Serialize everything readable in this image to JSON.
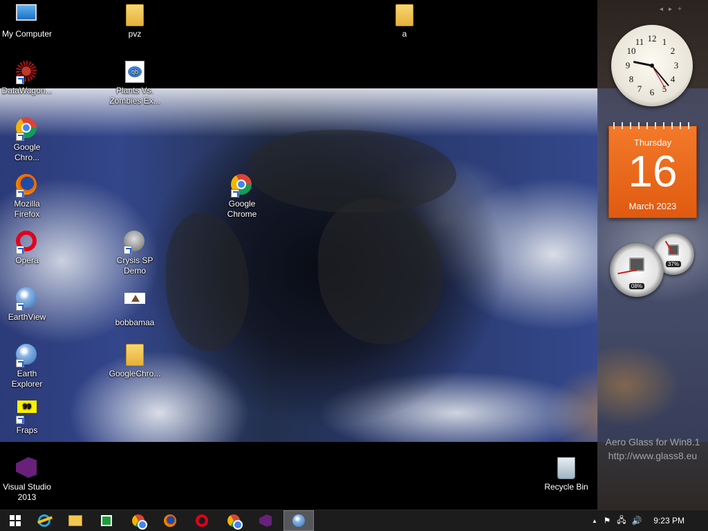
{
  "desktop": {
    "icons": [
      {
        "label": "My Computer"
      },
      {
        "label": "pvz"
      },
      {
        "label": "a"
      },
      {
        "label": "DataWagon..."
      },
      {
        "label": "Plants Vs.\nZombies Ex..."
      },
      {
        "label": "Google\nChro..."
      },
      {
        "label": "Google\nChrome"
      },
      {
        "label": "Mozilla\nFirefox"
      },
      {
        "label": "Opera"
      },
      {
        "label": "Crysis SP\nDemo"
      },
      {
        "label": "EarthView"
      },
      {
        "label": "bobbamaa"
      },
      {
        "label": "Earth Explorer"
      },
      {
        "label": "GoogleChro..."
      },
      {
        "label": "Fraps"
      },
      {
        "label": "Visual Studio\n2013"
      },
      {
        "label": "Recycle Bin"
      }
    ],
    "fraps_badge": "99"
  },
  "sidebar": {
    "nav_prev": "◂",
    "nav_next": "▸",
    "nav_add": "+",
    "clock": {
      "hour": 9,
      "minute": 23,
      "second": 25
    },
    "calendar": {
      "weekday": "Thursday",
      "day": "16",
      "month_year": "March 2023"
    },
    "cpu_meter": {
      "readout": "08%",
      "value": 8
    },
    "memory_meter": {
      "readout": "37%",
      "value": 37
    },
    "watermark_line1": "Aero Glass for Win8.1",
    "watermark_line2": "http://www.glass8.eu"
  },
  "taskbar": {
    "apps": [
      "start-button",
      "internet-explorer",
      "file-explorer",
      "windows-store",
      "google-chrome",
      "mozilla-firefox",
      "opera",
      "google-chrome-2",
      "visual-studio",
      "earth-view"
    ],
    "active_app": "earth-view",
    "tray_expand": "▲",
    "time": "9:23 PM"
  }
}
